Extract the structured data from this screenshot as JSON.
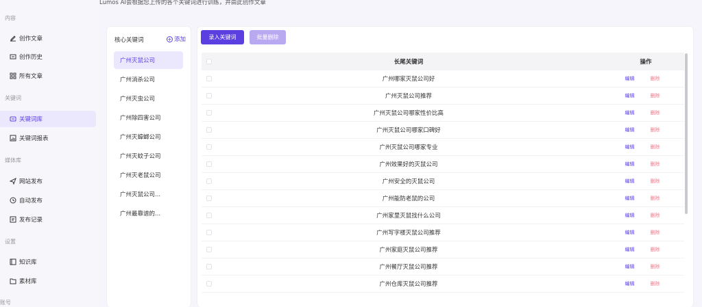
{
  "page_description": "Lumos AI会根据您上传的各个关键词进行训练，并由此创作文章",
  "sidebar": {
    "sections": [
      {
        "label": "内容"
      },
      {
        "label": "关键词"
      },
      {
        "label": "媒体库"
      },
      {
        "label": "设置"
      },
      {
        "label": "账号"
      }
    ],
    "items": [
      {
        "label": "创作文章",
        "icon": "edit-icon"
      },
      {
        "label": "创作历史",
        "icon": "history-icon"
      },
      {
        "label": "所有文章",
        "icon": "grid-icon"
      },
      {
        "label": "关键词库",
        "icon": "keyword-library-icon",
        "active": true
      },
      {
        "label": "关键词报表",
        "icon": "report-icon"
      },
      {
        "label": "网站发布",
        "icon": "send-icon"
      },
      {
        "label": "自动发布",
        "icon": "clock-icon"
      },
      {
        "label": "发布记录",
        "icon": "record-icon"
      },
      {
        "label": "知识库",
        "icon": "book-icon"
      },
      {
        "label": "素材库",
        "icon": "folder-icon"
      }
    ]
  },
  "keywords_panel": {
    "title": "核心关键词",
    "add_label": "添加",
    "items": [
      "广州灭鼠公司",
      "广州消杀公司",
      "广州灭虫公司",
      "广州除四害公司",
      "广州灭蟑螂公司",
      "广州灭蚊子公司",
      "广州灭老鼠公司",
      "广州灭鼠公司...",
      "广州最靠谱的..."
    ],
    "active_index": 0
  },
  "toolbar": {
    "add_label": "录入关键词",
    "batch_delete_label": "批量删除"
  },
  "table": {
    "headers": {
      "keyword": "长尾关键词",
      "actions": "操作"
    },
    "edit_label": "编辑",
    "delete_label": "删除",
    "rows": [
      "广州哪家灭鼠公司好",
      "广州灭鼠公司推荐",
      "广州灭鼠公司哪家性价比高",
      "广州灭鼠公司哪家口碑好",
      "广州灭鼠公司哪家专业",
      "广州效果好的灭鼠公司",
      "广州安全的灭鼠公司",
      "广州能防老鼠的公司",
      "广州家里灭鼠找什么公司",
      "广州写字楼灭鼠公司推荐",
      "广州家庭灭鼠公司推荐",
      "广州餐厅灭鼠公司推荐",
      "广州仓库灭鼠公司推荐"
    ]
  },
  "colors": {
    "accent": "#5b3fe0",
    "accent_light": "#ebe7fd",
    "danger": "#f07a8a"
  }
}
